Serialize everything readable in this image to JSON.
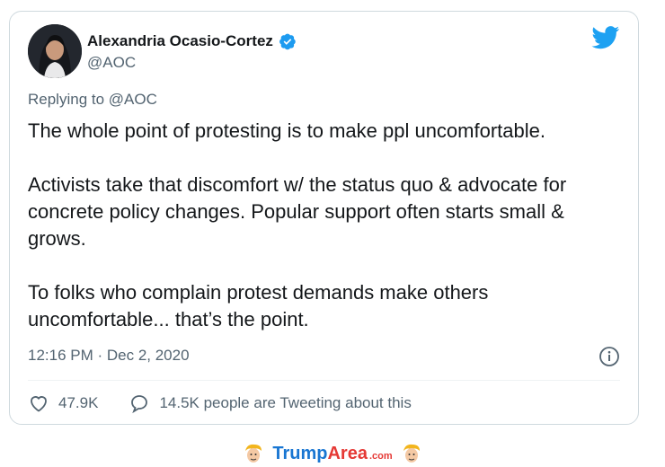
{
  "author": {
    "name": "Alexandria Ocasio-Cortez",
    "handle": "@AOC",
    "verified": true
  },
  "reply_context": "Replying to @AOC",
  "tweet": {
    "paragraphs": [
      "The whole point of protesting is to make ppl uncomfortable.",
      "Activists take that discomfort w/ the status quo & advocate for concrete policy changes. Popular support often starts small & grows.",
      "To folks who complain protest demands make others uncomfortable... that’s the point."
    ],
    "timestamp": "12:16 PM · Dec 2, 2020"
  },
  "actions": {
    "likes": "47.9K",
    "tweeting_count": "14.5K people are Tweeting about this"
  },
  "footer": {
    "brand_part1": "Trump",
    "brand_part2": "Area",
    "brand_part3": ".com"
  },
  "colors": {
    "twitter_blue": "#1da1f2",
    "verified_blue": "#1d9bf0",
    "muted_text": "#536471",
    "brand_blue": "#1976d2",
    "brand_red": "#e53935"
  },
  "icons": [
    "verified-badge-icon",
    "twitter-bird-icon",
    "info-icon",
    "heart-icon",
    "comment-bubble-icon",
    "mascot-icon"
  ]
}
